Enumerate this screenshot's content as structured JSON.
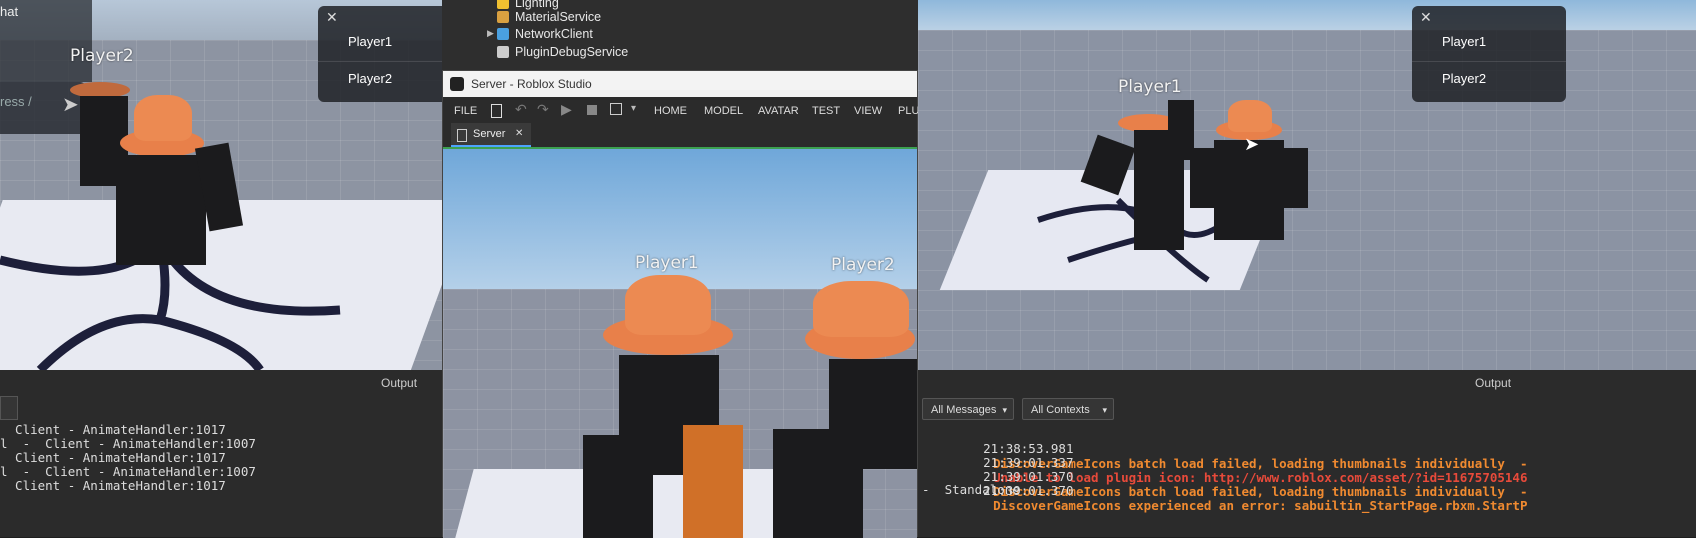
{
  "left_window": {
    "chat_partial_text": "hat",
    "chat_input_partial": "ress /",
    "nametag": "Player2",
    "player_list": [
      "Player1",
      "Player2"
    ],
    "output_title": "Output",
    "log_lines": [
      "  Client - AnimateHandler:1017",
      "l  -  Client - AnimateHandler:1007",
      "  Client - AnimateHandler:1017",
      "l  -  Client - AnimateHandler:1007",
      "  Client - AnimateHandler:1017"
    ]
  },
  "explorer": {
    "items": [
      {
        "label": "Lighting",
        "color": "#f0c030"
      },
      {
        "label": "MaterialService",
        "color": "#d9a040"
      },
      {
        "label": "NetworkClient",
        "color": "#4aa0e0"
      },
      {
        "label": "PluginDebugService",
        "color": "#cccccc"
      }
    ]
  },
  "server_window": {
    "title": "Server - Roblox Studio",
    "menu": [
      "FILE",
      "HOME",
      "MODEL",
      "AVATAR",
      "TEST",
      "VIEW",
      "PLU"
    ],
    "tab_label": "Server",
    "tab_close": "✕",
    "nametag_left": "Player1",
    "nametag_right": "Player2"
  },
  "right_window": {
    "nametag": "Player1",
    "player_list": [
      "Player1",
      "Player2"
    ],
    "output_title": "Output",
    "filter_messages": "All Messages",
    "filter_contexts": "All Contexts",
    "log_entries": [
      {
        "time": "21:38:53.981",
        "text": "DiscoverGameIcons batch load failed, loading thumbnails individually  -",
        "color": "#f08a30"
      },
      {
        "time": "21:39:01.337",
        "text": "Unable to load plugin icon: http://www.roblox.com/asset/?id=11675705146",
        "color": "#e84a3a"
      },
      {
        "time": "21:39:01.370",
        "text": "DiscoverGameIcons batch load failed, loading thumbnails individually  -",
        "color": "#f08a30"
      },
      {
        "time": "21:39:01.370",
        "text": "DiscoverGameIcons experienced an error: sabuiltin_StartPage.rbxm.StartP",
        "color": "#f08a30"
      }
    ],
    "footer_text": "-  Standalone"
  },
  "colors": {
    "sky_top": "#a8c4e0",
    "floor": "#8a91a0",
    "hat_orange": "#ec8a52",
    "studio_bg": "#2b2b2b"
  }
}
